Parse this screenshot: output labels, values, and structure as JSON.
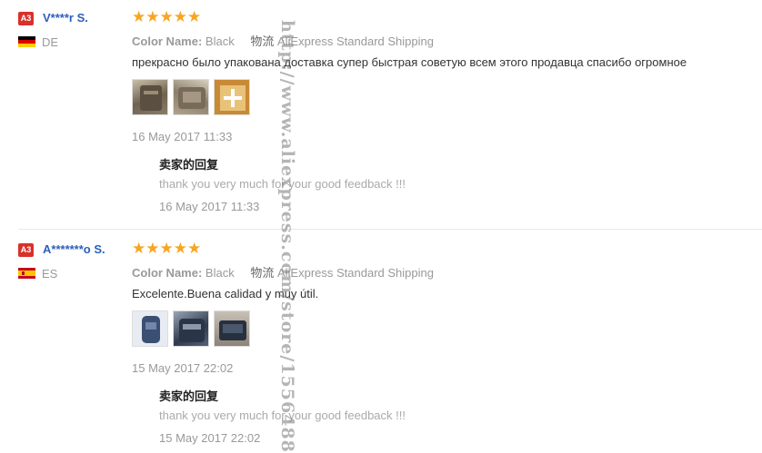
{
  "reviews": [
    {
      "badge": "A3",
      "user": "V****r S.",
      "country": "DE",
      "flag": "germany-flag",
      "stars": "★★★★★",
      "color_label": "Color Name:",
      "color_value": "Black",
      "shipping_label": "物流",
      "shipping_value": "AliExpress Standard Shipping",
      "comment": "прекрасно было упакована доставка супер быстрая советую всем этого продавца спасибо огромное",
      "photos": [
        "photo-bag-front",
        "photo-bag-inside",
        "photo-packaging"
      ],
      "date": "16 May 2017 11:33",
      "reply_title": "卖家的回复",
      "reply_text": "thank you very much for your good feedback !!!",
      "reply_date": "16 May 2017 11:33"
    },
    {
      "badge": "A3",
      "user": "A*******o S.",
      "country": "ES",
      "flag": "spain-flag",
      "stars": "★★★★★",
      "color_label": "Color Name:",
      "color_value": "Black",
      "shipping_label": "物流",
      "shipping_value": "AliExpress Standard Shipping",
      "comment": "Excelente.Buena calidad y muy útil.",
      "photos": [
        "photo-backpack-blue",
        "photo-bag-dark",
        "photo-bag-open"
      ],
      "date": "15 May 2017 22:02",
      "reply_title": "卖家的回复",
      "reply_text": "thank you very much for your good feedback !!!",
      "reply_date": "15 May 2017 22:02"
    }
  ],
  "watermark": "http://www.aliexpress.com/store/1556488",
  "colors": {
    "star": "#f6a623",
    "user": "#2c5fbb",
    "badge": "#d9302a"
  }
}
